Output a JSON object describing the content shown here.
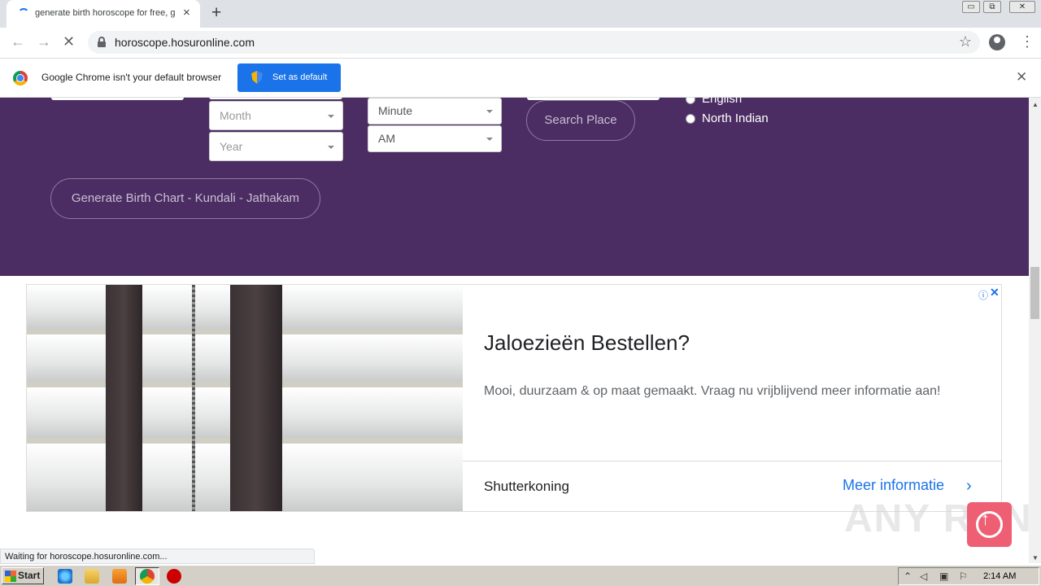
{
  "browser": {
    "tab": {
      "title": "generate birth horoscope for free, g",
      "close_icon": "×"
    },
    "new_tab_icon": "+",
    "window_controls": {
      "minimize": "▭",
      "restore": "⧉",
      "close": "✕"
    },
    "nav": {
      "back": "←",
      "forward": "→",
      "stop": "✕"
    },
    "address": "horoscope.hosuronline.com",
    "bookmark_icon": "☆",
    "menu_icon": "⋮"
  },
  "infobar": {
    "message": "Google Chrome isn't your default browser",
    "button_label": "Set as default",
    "close_icon": "✕"
  },
  "form": {
    "month_placeholder": "Month",
    "year_placeholder": "Year",
    "minute_value": "Minute",
    "ampm_value": "AM",
    "search_place_label": "Search Place",
    "language_options": [
      "English",
      "North Indian"
    ],
    "generate_label": "Generate Birth Chart - Kundali - Jathakam"
  },
  "ad": {
    "headline": "Jaloezieën Bestellen?",
    "description": "Mooi, duurzaam & op maat gemaakt. Vraag nu vrijblijvend meer informatie aan!",
    "brand": "Shutterkoning",
    "cta": "Meer informatie",
    "cta_icon": "›",
    "info_icon": "ⓘ",
    "close_icon": "✕"
  },
  "watermark": "ANY RUN",
  "scroll_top_icon": "↑",
  "status": "Waiting for horoscope.hosuronline.com...",
  "taskbar": {
    "start_label": "Start",
    "clock": "2:14 AM"
  },
  "colors": {
    "form_background": "#4b2d63",
    "chrome_blue": "#1a73e8",
    "scroll_top_button": "#ef5f73"
  }
}
